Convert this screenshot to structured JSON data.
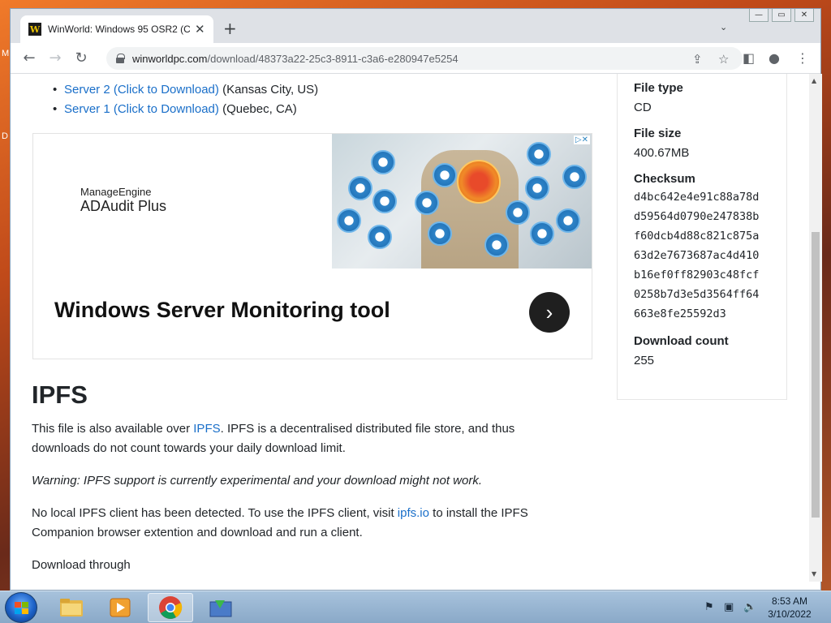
{
  "desktop": {
    "glimpse_letters": [
      "M",
      "D"
    ]
  },
  "browser": {
    "tab_title": "WinWorld: Windows 95 OSR2 (C",
    "favicon_letter": "W",
    "url_host": "winworldpc.com",
    "url_path": "/download/48373a22-25c3-8911-c3a6-e280947e5254"
  },
  "page": {
    "servers": [
      {
        "link": "Server 2 (Click to Download)",
        "location": "(Kansas City, US)"
      },
      {
        "link": "Server 1 (Click to Download)",
        "location": "(Quebec, CA)"
      }
    ],
    "ad": {
      "brand_small": "ManageEngine",
      "brand_big": "ADAudit Plus",
      "headline": "Windows Server Monitoring tool",
      "adchoices": "▷✕"
    },
    "ipfs": {
      "heading": "IPFS",
      "p1_a": "This file is also available over ",
      "p1_link": "IPFS",
      "p1_b": ". IPFS is a decentralised distributed file store, and thus downloads do not count towards your daily download limit.",
      "warning": "Warning: IPFS support is currently experimental and your download might not work.",
      "p3_a": "No local IPFS client has been detected. To use the IPFS client, visit ",
      "p3_link": "ipfs.io",
      "p3_b": " to install the IPFS Companion browser extention and download and run a client.",
      "p4": "Download through"
    },
    "sidebar": {
      "file_type_label": "File type",
      "file_type": "CD",
      "file_size_label": "File size",
      "file_size": "400.67MB",
      "checksum_label": "Checksum",
      "checksum_lines": [
        "d4bc642e4e91c88a78d",
        "d59564d0790e247838b",
        "f60dcb4d88c821c875a",
        "63d2e7673687ac4d410",
        "b16ef0ff82903c48fcf",
        "0258b7d3e5d3564ff64",
        "663e8fe25592d3"
      ],
      "download_count_label": "Download count",
      "download_count": "255"
    }
  },
  "taskbar": {
    "time": "8:53 AM",
    "date": "3/10/2022"
  },
  "colors": {
    "link": "#1a6fc9",
    "ad_arrow": "#1f1f1f"
  }
}
